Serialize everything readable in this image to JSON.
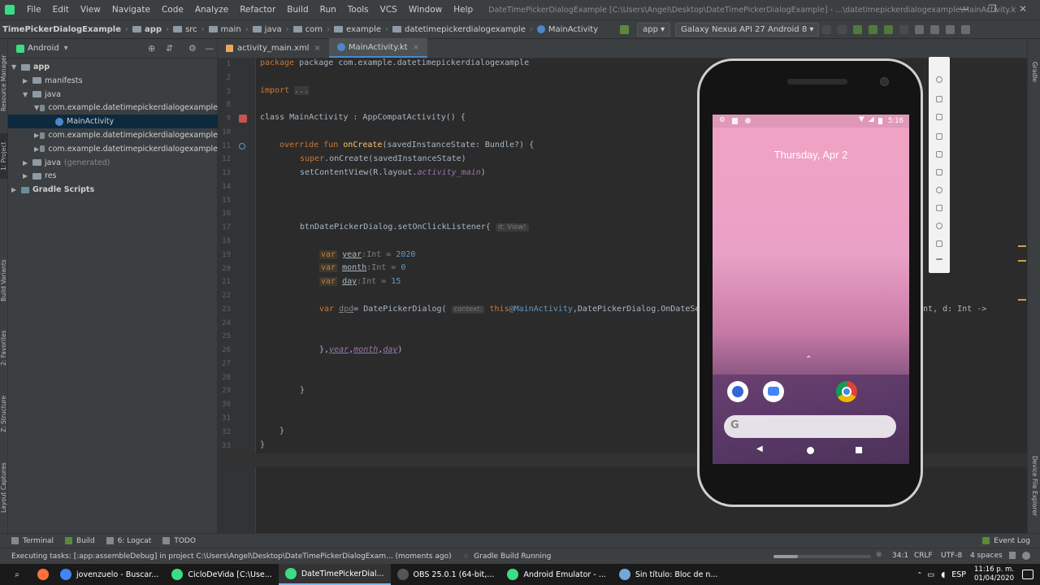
{
  "window": {
    "title": "DateTimePickerDialogExample [C:\\Users\\Angel\\Desktop\\DateTimePickerDialogExample] - ...\\datetimepickerdialogexample\\MainActivity.kt [app]",
    "menu": [
      "File",
      "Edit",
      "View",
      "Navigate",
      "Code",
      "Analyze",
      "Refactor",
      "Build",
      "Run",
      "Tools",
      "VCS",
      "Window",
      "Help"
    ]
  },
  "breadcrumbs": [
    "TimePickerDialogExample",
    "app",
    "src",
    "main",
    "java",
    "com",
    "example",
    "datetimepickerdialogexample",
    "MainActivity"
  ],
  "run_config": "app",
  "device": "Galaxy Nexus API 27 Android 8",
  "project_panel": {
    "view": "Android",
    "tree": [
      {
        "label": "app",
        "indent": 0,
        "icon": "folder",
        "arrow": "▼"
      },
      {
        "label": "manifests",
        "indent": 1,
        "icon": "folder",
        "arrow": "▶"
      },
      {
        "label": "java",
        "indent": 1,
        "icon": "folder",
        "arrow": "▼"
      },
      {
        "label": "com.example.datetimepickerdialogexample",
        "indent": 2,
        "icon": "package",
        "arrow": "▼"
      },
      {
        "label": "MainActivity",
        "indent": 3,
        "icon": "kotlin",
        "arrow": "",
        "selected": true
      },
      {
        "label": "com.example.datetimepickerdialogexample",
        "indent": 2,
        "icon": "package",
        "arrow": "▶"
      },
      {
        "label": "com.example.datetimepickerdialogexample",
        "indent": 2,
        "icon": "package",
        "arrow": "▶"
      },
      {
        "label": "java",
        "suffix": "(generated)",
        "indent": 1,
        "icon": "folder",
        "arrow": "▶"
      },
      {
        "label": "res",
        "indent": 1,
        "icon": "folder",
        "arrow": "▶"
      },
      {
        "label": "Gradle Scripts",
        "indent": 0,
        "icon": "gradle",
        "arrow": "▶"
      }
    ]
  },
  "editor_tabs": [
    {
      "label": "activity_main.xml",
      "active": false
    },
    {
      "label": "MainActivity.kt",
      "active": true
    }
  ],
  "line_numbers": [
    "1",
    "2",
    "3",
    "8",
    "9",
    "10",
    "11",
    "12",
    "13",
    "14",
    "15",
    "16",
    "17",
    "18",
    "19",
    "20",
    "21",
    "22",
    "23",
    "24",
    "25",
    "26",
    "27",
    "28",
    "29",
    "30",
    "31",
    "32",
    "33",
    "34"
  ],
  "code": {
    "l1": "package com.example.datetimepickerdialogexample",
    "l3_kw": "import",
    "l3_fold": "...",
    "l9": "class MainActivity : AppCompatActivity() {",
    "l11_a": "override fun ",
    "l11_b": "onCreate",
    "l11_c": "(savedInstanceState: Bundle?) {",
    "l12_a": "super",
    "l12_b": ".onCreate(savedInstanceState)",
    "l13_a": "setContentView(R.layout.",
    "l13_b": "activity_main",
    "l13_c": ")",
    "l17_a": "btnDatePickerDialog.setOnClickListener{ ",
    "l17_hint": "it: View!",
    "l19_kw": "var",
    "l19_name": "year",
    "l19_type": ":Int = ",
    "l19_val": "2020",
    "l20_kw": "var",
    "l20_name": "month",
    "l20_type": ":Int = ",
    "l20_val": "0",
    "l21_kw": "var",
    "l21_name": "day",
    "l21_type": ":Int = ",
    "l21_val": "15",
    "l23_kw": "var",
    "l23_name": "dpd",
    "l23_a": "= DatePickerDialog( ",
    "l23_hint": "context:",
    "l23_this": " this",
    "l23_at": "@MainActivity",
    "l23_b": ",DatePickerDialog.OnDateSe",
    "l23_tail": "nt, d: Int ->",
    "l26_a": "},",
    "l26_b": "year",
    "l26_c": ",",
    "l26_d": "month",
    "l26_e": ",",
    "l26_f": "day",
    "l26_g": ")",
    "l29": "}",
    "l32": "}",
    "l33": "}"
  },
  "emulator": {
    "time": "5:16",
    "date": "Thursday, Apr 2"
  },
  "bottom_tools": [
    "Terminal",
    "Build",
    "6: Logcat",
    "TODO"
  ],
  "event_log": "Event Log",
  "status": {
    "message": "Executing tasks: [:app:assembleDebug] in project C:\\Users\\Angel\\Desktop\\DateTimePickerDialogExam... (moments ago)",
    "build": "Gradle Build Running",
    "pos": "34:1",
    "eol": "CRLF",
    "enc": "UTF-8",
    "indent": "4 spaces"
  },
  "left_strip": [
    "Resource Manager",
    "1: Project",
    "Build Variants",
    "2: Favorites",
    "Z: Structure",
    "Layout Captures"
  ],
  "right_strip": [
    "Gradle",
    "Device File Explorer"
  ],
  "taskbar": {
    "items": [
      {
        "label": "jovenzuelo - Buscar...",
        "color": "#4285f4"
      },
      {
        "label": "CicloDeVida [C:\\Use...",
        "color": "#3ddc84"
      },
      {
        "label": "DateTimePickerDial...",
        "color": "#3ddc84",
        "active": true
      },
      {
        "label": "OBS 25.0.1 (64-bit,...",
        "color": "#555555"
      },
      {
        "label": "Android Emulator - ...",
        "color": "#3ddc84"
      },
      {
        "label": "Sin título: Bloc de n...",
        "color": "#6fa8dc"
      }
    ],
    "lang": "ESP",
    "time": "11:16 p. m.",
    "date": "01/04/2020"
  }
}
